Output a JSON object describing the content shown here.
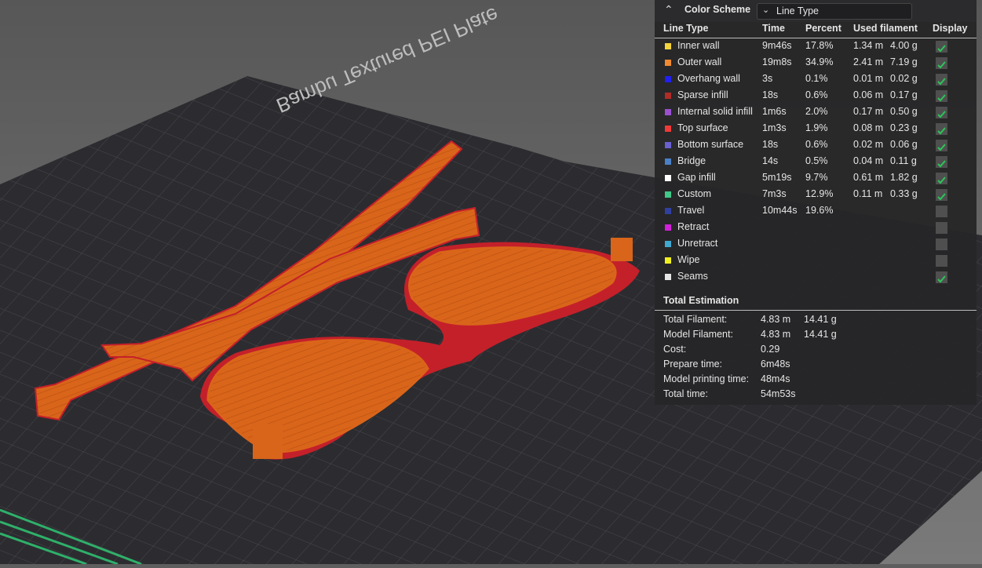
{
  "bed": {
    "label": "Bambu Textured PEI Plate"
  },
  "header": {
    "title": "Color Scheme",
    "selected_scheme": "Line Type"
  },
  "columns": [
    "Line Type",
    "Time",
    "Percent",
    "Used filament",
    "Display"
  ],
  "rows": [
    {
      "name": "Inner wall",
      "color": "#f5d43b",
      "time": "9m46s",
      "percent": "17.8%",
      "length": "1.34 m",
      "weight": "4.00 g",
      "display": true
    },
    {
      "name": "Outer wall",
      "color": "#f08a30",
      "time": "19m8s",
      "percent": "34.9%",
      "length": "2.41 m",
      "weight": "7.19 g",
      "display": true
    },
    {
      "name": "Overhang wall",
      "color": "#2020f0",
      "time": "3s",
      "percent": "0.1%",
      "length": "0.01 m",
      "weight": "0.02 g",
      "display": true
    },
    {
      "name": "Sparse infill",
      "color": "#b02c28",
      "time": "18s",
      "percent": "0.6%",
      "length": "0.06 m",
      "weight": "0.17 g",
      "display": true
    },
    {
      "name": "Internal solid infill",
      "color": "#9a50d0",
      "time": "1m6s",
      "percent": "2.0%",
      "length": "0.17 m",
      "weight": "0.50 g",
      "display": true
    },
    {
      "name": "Top surface",
      "color": "#f03a3a",
      "time": "1m3s",
      "percent": "1.9%",
      "length": "0.08 m",
      "weight": "0.23 g",
      "display": true
    },
    {
      "name": "Bottom surface",
      "color": "#6a60d0",
      "time": "18s",
      "percent": "0.6%",
      "length": "0.02 m",
      "weight": "0.06 g",
      "display": true
    },
    {
      "name": "Bridge",
      "color": "#4a80c8",
      "time": "14s",
      "percent": "0.5%",
      "length": "0.04 m",
      "weight": "0.11 g",
      "display": true
    },
    {
      "name": "Gap infill",
      "color": "#ffffff",
      "time": "5m19s",
      "percent": "9.7%",
      "length": "0.61 m",
      "weight": "1.82 g",
      "display": true
    },
    {
      "name": "Custom",
      "color": "#40c888",
      "time": "7m3s",
      "percent": "12.9%",
      "length": "0.11 m",
      "weight": "0.33 g",
      "display": true
    },
    {
      "name": "Travel",
      "color": "#3040a0",
      "time": "10m44s",
      "percent": "19.6%",
      "length": "",
      "weight": "",
      "display": false
    },
    {
      "name": "Retract",
      "color": "#d020d8",
      "time": "",
      "percent": "",
      "length": "",
      "weight": "",
      "display": false
    },
    {
      "name": "Unretract",
      "color": "#40a8d0",
      "time": "",
      "percent": "",
      "length": "",
      "weight": "",
      "display": false
    },
    {
      "name": "Wipe",
      "color": "#f0f020",
      "time": "",
      "percent": "",
      "length": "",
      "weight": "",
      "display": false
    },
    {
      "name": "Seams",
      "color": "#e6e6e6",
      "time": "",
      "percent": "",
      "length": "",
      "weight": "",
      "display": true
    }
  ],
  "estimation": {
    "title": "Total Estimation",
    "rows": [
      {
        "label": "Total Filament:",
        "v1": "4.83 m",
        "v2": "14.41 g"
      },
      {
        "label": "Model Filament:",
        "v1": "4.83 m",
        "v2": "14.41 g"
      },
      {
        "label": "Cost:",
        "v1": "0.29",
        "v2": ""
      },
      {
        "label": "Prepare time:",
        "v1": "6m48s",
        "v2": ""
      },
      {
        "label": "Model printing time:",
        "v1": "48m4s",
        "v2": ""
      },
      {
        "label": "Total time:",
        "v1": "54m53s",
        "v2": ""
      }
    ]
  },
  "colors": {
    "accent_check": "#2ec45a",
    "model_orange": "#d9651a",
    "model_red": "#c4202a"
  }
}
